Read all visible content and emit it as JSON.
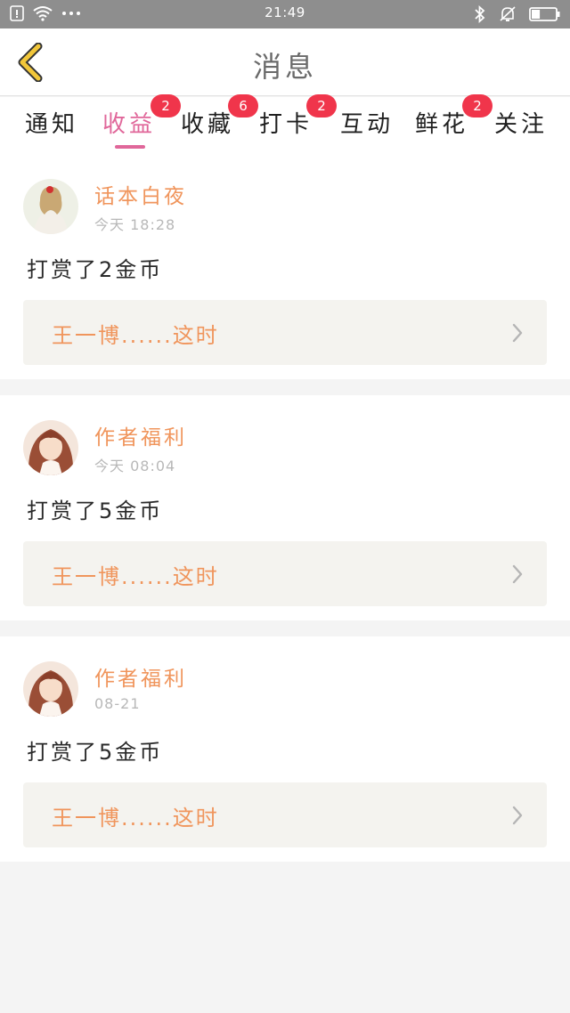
{
  "status_bar": {
    "time": "21:49",
    "left_icons": [
      "sim-icon",
      "wifi-icon",
      "more-icon"
    ],
    "right_icons": [
      "bluetooth-icon",
      "mute-icon",
      "battery-icon"
    ],
    "battery_level": 0.35
  },
  "header": {
    "title": "消息",
    "back_icon": "chevron-left-icon",
    "back_color": "#f2c73a"
  },
  "tabs": [
    {
      "label": "通知",
      "badge": "",
      "active": false
    },
    {
      "label": "收益",
      "badge": "2",
      "active": true
    },
    {
      "label": "收藏",
      "badge": "6",
      "active": false
    },
    {
      "label": "打卡",
      "badge": "2",
      "active": false
    },
    {
      "label": "互动",
      "badge": "",
      "active": false
    },
    {
      "label": "鲜花",
      "badge": "2",
      "active": false
    },
    {
      "label": "关注",
      "badge": "",
      "active": false
    }
  ],
  "colors": {
    "accent": "#e0679a",
    "badge": "#f0354b",
    "name": "#f0955c",
    "quote_bg": "#f4f3ef"
  },
  "messages": [
    {
      "name": "话本白夜",
      "time": "今天 18:28",
      "text": "打赏了2金币",
      "quote": "王一博......这时"
    },
    {
      "name": "作者福利",
      "time": "今天 08:04",
      "text": "打赏了5金币",
      "quote": "王一博......这时"
    },
    {
      "name": "作者福利",
      "time": "08-21",
      "text": "打赏了5金币",
      "quote": "王一博......这时"
    }
  ]
}
